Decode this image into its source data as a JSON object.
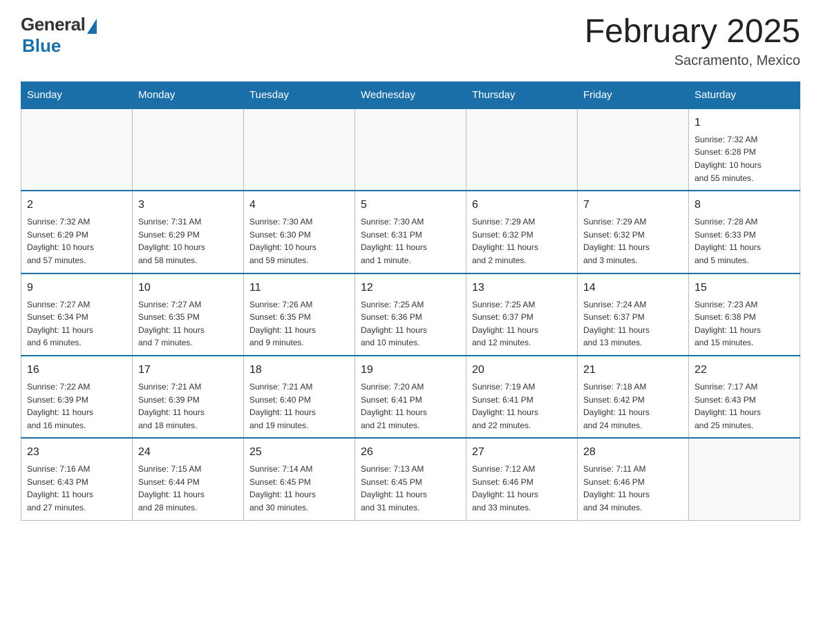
{
  "header": {
    "logo_general": "General",
    "logo_blue": "Blue",
    "month_title": "February 2025",
    "location": "Sacramento, Mexico"
  },
  "days_of_week": [
    "Sunday",
    "Monday",
    "Tuesday",
    "Wednesday",
    "Thursday",
    "Friday",
    "Saturday"
  ],
  "weeks": [
    [
      {
        "day": "",
        "info": ""
      },
      {
        "day": "",
        "info": ""
      },
      {
        "day": "",
        "info": ""
      },
      {
        "day": "",
        "info": ""
      },
      {
        "day": "",
        "info": ""
      },
      {
        "day": "",
        "info": ""
      },
      {
        "day": "1",
        "info": "Sunrise: 7:32 AM\nSunset: 6:28 PM\nDaylight: 10 hours\nand 55 minutes."
      }
    ],
    [
      {
        "day": "2",
        "info": "Sunrise: 7:32 AM\nSunset: 6:29 PM\nDaylight: 10 hours\nand 57 minutes."
      },
      {
        "day": "3",
        "info": "Sunrise: 7:31 AM\nSunset: 6:29 PM\nDaylight: 10 hours\nand 58 minutes."
      },
      {
        "day": "4",
        "info": "Sunrise: 7:30 AM\nSunset: 6:30 PM\nDaylight: 10 hours\nand 59 minutes."
      },
      {
        "day": "5",
        "info": "Sunrise: 7:30 AM\nSunset: 6:31 PM\nDaylight: 11 hours\nand 1 minute."
      },
      {
        "day": "6",
        "info": "Sunrise: 7:29 AM\nSunset: 6:32 PM\nDaylight: 11 hours\nand 2 minutes."
      },
      {
        "day": "7",
        "info": "Sunrise: 7:29 AM\nSunset: 6:32 PM\nDaylight: 11 hours\nand 3 minutes."
      },
      {
        "day": "8",
        "info": "Sunrise: 7:28 AM\nSunset: 6:33 PM\nDaylight: 11 hours\nand 5 minutes."
      }
    ],
    [
      {
        "day": "9",
        "info": "Sunrise: 7:27 AM\nSunset: 6:34 PM\nDaylight: 11 hours\nand 6 minutes."
      },
      {
        "day": "10",
        "info": "Sunrise: 7:27 AM\nSunset: 6:35 PM\nDaylight: 11 hours\nand 7 minutes."
      },
      {
        "day": "11",
        "info": "Sunrise: 7:26 AM\nSunset: 6:35 PM\nDaylight: 11 hours\nand 9 minutes."
      },
      {
        "day": "12",
        "info": "Sunrise: 7:25 AM\nSunset: 6:36 PM\nDaylight: 11 hours\nand 10 minutes."
      },
      {
        "day": "13",
        "info": "Sunrise: 7:25 AM\nSunset: 6:37 PM\nDaylight: 11 hours\nand 12 minutes."
      },
      {
        "day": "14",
        "info": "Sunrise: 7:24 AM\nSunset: 6:37 PM\nDaylight: 11 hours\nand 13 minutes."
      },
      {
        "day": "15",
        "info": "Sunrise: 7:23 AM\nSunset: 6:38 PM\nDaylight: 11 hours\nand 15 minutes."
      }
    ],
    [
      {
        "day": "16",
        "info": "Sunrise: 7:22 AM\nSunset: 6:39 PM\nDaylight: 11 hours\nand 16 minutes."
      },
      {
        "day": "17",
        "info": "Sunrise: 7:21 AM\nSunset: 6:39 PM\nDaylight: 11 hours\nand 18 minutes."
      },
      {
        "day": "18",
        "info": "Sunrise: 7:21 AM\nSunset: 6:40 PM\nDaylight: 11 hours\nand 19 minutes."
      },
      {
        "day": "19",
        "info": "Sunrise: 7:20 AM\nSunset: 6:41 PM\nDaylight: 11 hours\nand 21 minutes."
      },
      {
        "day": "20",
        "info": "Sunrise: 7:19 AM\nSunset: 6:41 PM\nDaylight: 11 hours\nand 22 minutes."
      },
      {
        "day": "21",
        "info": "Sunrise: 7:18 AM\nSunset: 6:42 PM\nDaylight: 11 hours\nand 24 minutes."
      },
      {
        "day": "22",
        "info": "Sunrise: 7:17 AM\nSunset: 6:43 PM\nDaylight: 11 hours\nand 25 minutes."
      }
    ],
    [
      {
        "day": "23",
        "info": "Sunrise: 7:16 AM\nSunset: 6:43 PM\nDaylight: 11 hours\nand 27 minutes."
      },
      {
        "day": "24",
        "info": "Sunrise: 7:15 AM\nSunset: 6:44 PM\nDaylight: 11 hours\nand 28 minutes."
      },
      {
        "day": "25",
        "info": "Sunrise: 7:14 AM\nSunset: 6:45 PM\nDaylight: 11 hours\nand 30 minutes."
      },
      {
        "day": "26",
        "info": "Sunrise: 7:13 AM\nSunset: 6:45 PM\nDaylight: 11 hours\nand 31 minutes."
      },
      {
        "day": "27",
        "info": "Sunrise: 7:12 AM\nSunset: 6:46 PM\nDaylight: 11 hours\nand 33 minutes."
      },
      {
        "day": "28",
        "info": "Sunrise: 7:11 AM\nSunset: 6:46 PM\nDaylight: 11 hours\nand 34 minutes."
      },
      {
        "day": "",
        "info": ""
      }
    ]
  ]
}
